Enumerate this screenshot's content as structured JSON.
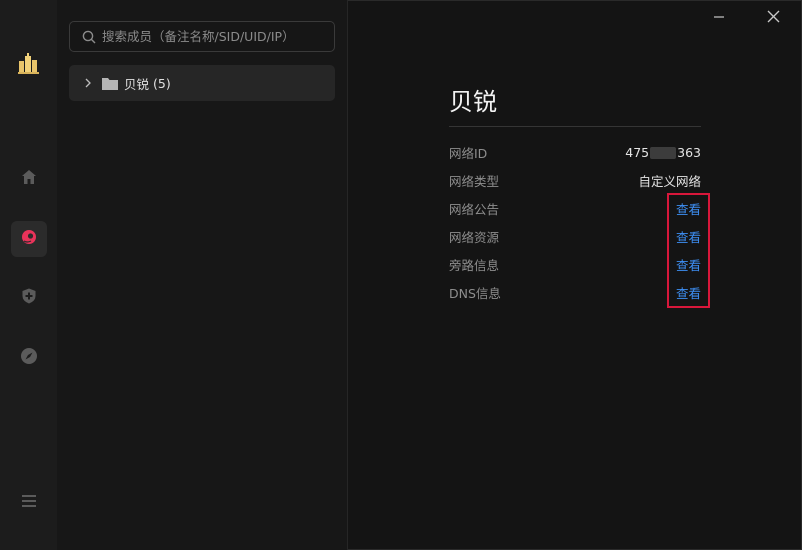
{
  "rail": {
    "items": [
      {
        "name": "home",
        "icon": "home-icon"
      },
      {
        "name": "network",
        "icon": "network-logo-icon",
        "active": true
      },
      {
        "name": "security",
        "icon": "shield-plus-icon"
      },
      {
        "name": "discover",
        "icon": "compass-icon"
      }
    ],
    "menu_icon": "menu-icon"
  },
  "panel": {
    "search_placeholder": "搜索成员（备注名称/SID/UID/IP）",
    "group": {
      "name": "贝锐",
      "count": "(5)"
    }
  },
  "main": {
    "title": "贝锐",
    "rows": [
      {
        "label": "网络ID",
        "value_prefix": "475",
        "value_suffix": "363"
      },
      {
        "label": "网络类型",
        "value": "自定义网络"
      },
      {
        "label": "网络公告",
        "link": "查看"
      },
      {
        "label": "网络资源",
        "link": "查看"
      },
      {
        "label": "旁路信息",
        "link": "查看"
      },
      {
        "label": "DNS信息",
        "link": "查看"
      }
    ]
  },
  "colors": {
    "accent_link": "#3d8ef2",
    "highlight_box": "#d8173b",
    "active_icon": "#e8335a"
  }
}
